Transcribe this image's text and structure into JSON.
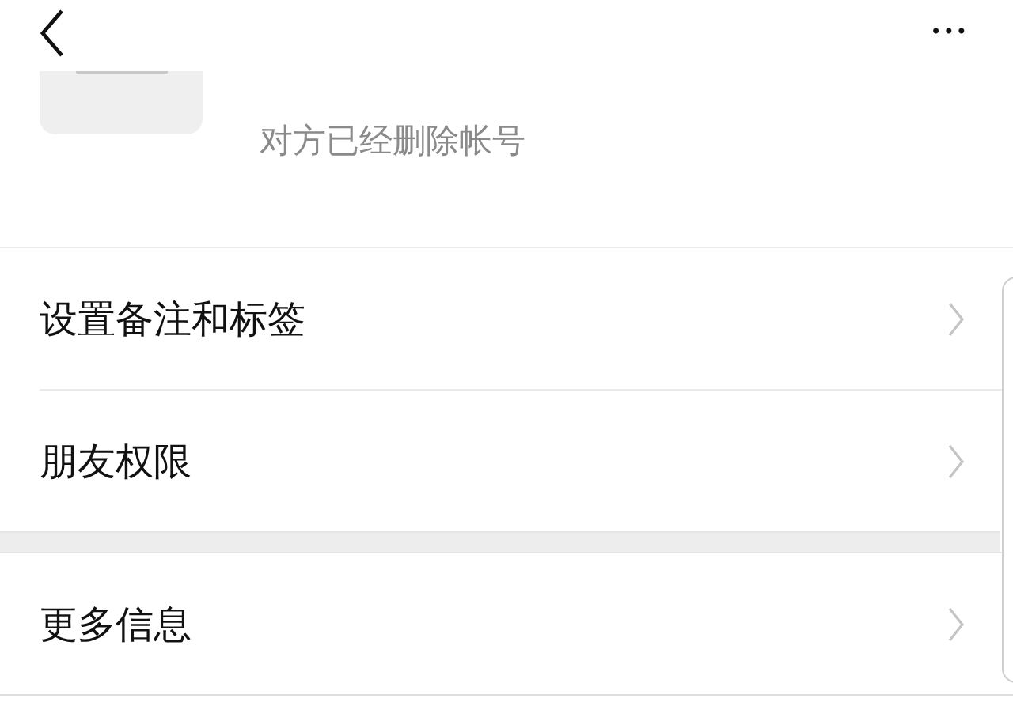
{
  "header": {
    "more": "•••"
  },
  "profile": {
    "status": "对方已经删除帐号"
  },
  "menu_groups": [
    {
      "items": [
        {
          "label": "设置备注和标签"
        },
        {
          "label": "朋友权限"
        }
      ]
    },
    {
      "items": [
        {
          "label": "更多信息"
        }
      ]
    }
  ]
}
